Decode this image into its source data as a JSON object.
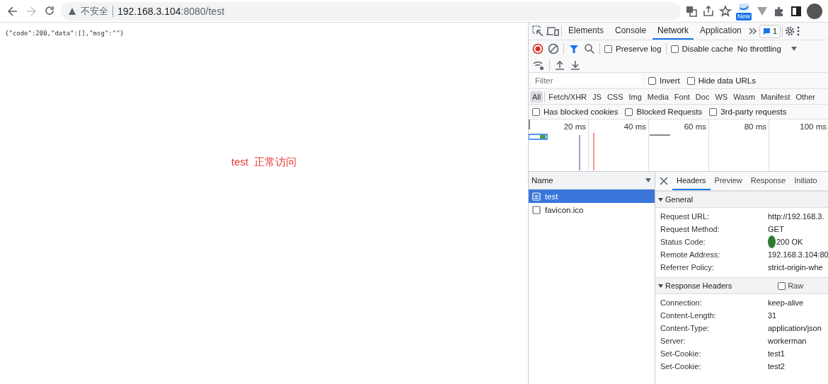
{
  "browser": {
    "address": {
      "security_label": "不安全",
      "host": "192.168.3.104",
      "path": ":8080/test"
    },
    "extension_badge": "New"
  },
  "page": {
    "json_text": "{\"code\":200,\"data\":[],\"msg\":\"\"}",
    "message": "test  正常访问"
  },
  "devtools": {
    "tabs": [
      {
        "label": "Elements",
        "selected": false
      },
      {
        "label": "Console",
        "selected": false
      },
      {
        "label": "Network",
        "selected": true
      },
      {
        "label": "Application",
        "selected": false
      }
    ],
    "issues_count": "1",
    "preserve_log": {
      "label": "Preserve log",
      "checked": false
    },
    "disable_cache": {
      "label": "Disable cache",
      "checked": false
    },
    "throttling": "No throttling",
    "filter": {
      "placeholder": "Filter"
    },
    "invert": {
      "label": "Invert",
      "checked": false
    },
    "hide_data_urls": {
      "label": "Hide data URLs",
      "checked": false
    },
    "types": [
      {
        "label": "All",
        "selected": true
      },
      {
        "label": "Fetch/XHR",
        "selected": false
      },
      {
        "label": "JS",
        "selected": false
      },
      {
        "label": "CSS",
        "selected": false
      },
      {
        "label": "Img",
        "selected": false
      },
      {
        "label": "Media",
        "selected": false
      },
      {
        "label": "Font",
        "selected": false
      },
      {
        "label": "Doc",
        "selected": false
      },
      {
        "label": "WS",
        "selected": false
      },
      {
        "label": "Wasm",
        "selected": false
      },
      {
        "label": "Manifest",
        "selected": false
      },
      {
        "label": "Other",
        "selected": false
      }
    ],
    "extra_filters": [
      {
        "label": "Has blocked cookies",
        "checked": false
      },
      {
        "label": "Blocked Requests",
        "checked": false
      },
      {
        "label": "3rd-party requests",
        "checked": false
      }
    ],
    "timeline": {
      "ticks": [
        "20 ms",
        "40 ms",
        "60 ms",
        "80 ms",
        "100 ms"
      ]
    },
    "requests": {
      "column": "Name",
      "rows": [
        {
          "name": "test",
          "kind": "document",
          "selected": true
        },
        {
          "name": "favicon.ico",
          "kind": "other",
          "selected": false
        }
      ]
    },
    "detail_tabs": [
      {
        "label": "Headers",
        "selected": true
      },
      {
        "label": "Preview",
        "selected": false
      },
      {
        "label": "Response",
        "selected": false
      },
      {
        "label": "Initiato",
        "selected": false
      }
    ],
    "sections": [
      {
        "title": "General",
        "expanded": true,
        "rows": [
          {
            "name": "Request URL:",
            "value": "http://192.168.3.",
            "kind": "text"
          },
          {
            "name": "Request Method:",
            "value": "GET",
            "kind": "text"
          },
          {
            "name": "Status Code:",
            "value": "200 OK",
            "kind": "status"
          },
          {
            "name": "Remote Address:",
            "value": "192.168.3.104:80",
            "kind": "text"
          },
          {
            "name": "Referrer Policy:",
            "value": "strict-origin-whe",
            "kind": "text"
          }
        ]
      },
      {
        "title": "Response Headers",
        "expanded": true,
        "raw": {
          "label": "Raw",
          "checked": false
        },
        "rows": [
          {
            "name": "Connection:",
            "value": "keep-alive",
            "kind": "text"
          },
          {
            "name": "Content-Length:",
            "value": "31",
            "kind": "text"
          },
          {
            "name": "Content-Type:",
            "value": "application/json",
            "kind": "text"
          },
          {
            "name": "Server:",
            "value": "workerman",
            "kind": "text"
          },
          {
            "name": "Set-Cookie:",
            "value": "test1",
            "kind": "text"
          },
          {
            "name": "Set-Cookie:",
            "value": "test2",
            "kind": "text"
          }
        ]
      }
    ]
  }
}
